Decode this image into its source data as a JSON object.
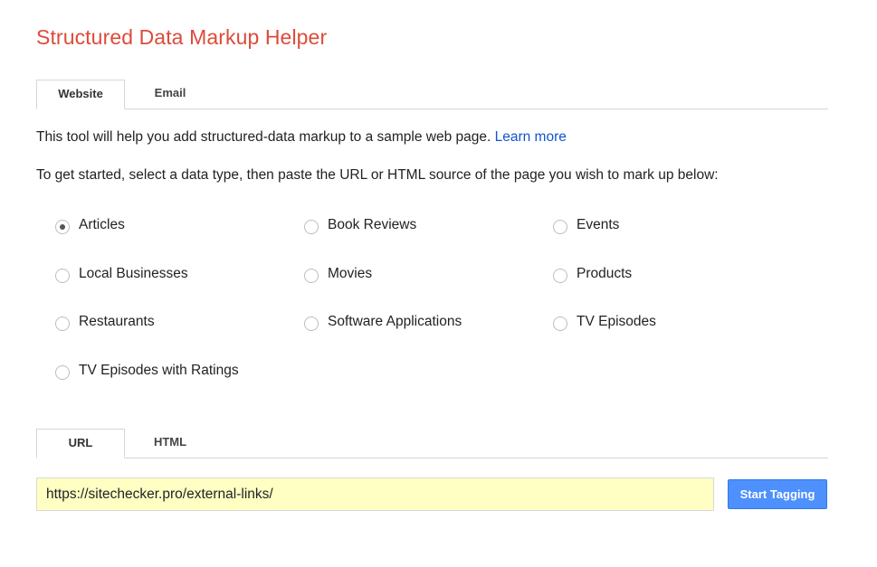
{
  "header": {
    "title": "Structured Data Markup Helper"
  },
  "source_tabs": [
    {
      "label": "Website",
      "active": true
    },
    {
      "label": "Email",
      "active": false
    }
  ],
  "intro": {
    "text": "This tool will help you add structured-data markup to a sample web page. ",
    "link_label": "Learn more"
  },
  "instructions": "To get started, select a data type, then paste the URL or HTML source of the page you wish to mark up below:",
  "data_types": [
    {
      "label": "Articles",
      "checked": true
    },
    {
      "label": "Book Reviews",
      "checked": false
    },
    {
      "label": "Events",
      "checked": false
    },
    {
      "label": "Local Businesses",
      "checked": false
    },
    {
      "label": "Movies",
      "checked": false
    },
    {
      "label": "Products",
      "checked": false
    },
    {
      "label": "Restaurants",
      "checked": false
    },
    {
      "label": "Software Applications",
      "checked": false
    },
    {
      "label": "TV Episodes",
      "checked": false
    },
    {
      "label": "TV Episodes with Ratings",
      "checked": false
    }
  ],
  "input_tabs": [
    {
      "label": "URL",
      "active": true
    },
    {
      "label": "HTML",
      "active": false
    }
  ],
  "url_field": {
    "value": "https://sitechecker.pro/external-links/"
  },
  "actions": {
    "start_label": "Start Tagging"
  },
  "colors": {
    "title": "#dd4b39",
    "link": "#1155cc",
    "input_background": "#ffffc4",
    "button": "#4d90fe"
  }
}
